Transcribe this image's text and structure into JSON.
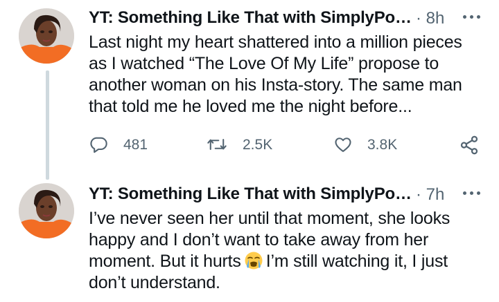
{
  "thread": {
    "tweets": [
      {
        "author": "YT: Something Like That with SimplyPo…",
        "separator": "·",
        "time": "8h",
        "lines": [
          "Last night my heart shattered into a million pieces",
          "as I watched “The Love Of My Life” propose to",
          "another woman on his Insta-story. The same man",
          "that told me he loved me the night before..."
        ],
        "actions": {
          "replies": "481",
          "retweets": "2.5K",
          "likes": "3.8K"
        }
      },
      {
        "author": "YT: Something Like That with SimplyPo…",
        "separator": "·",
        "time": "7h",
        "lines": [
          "I’ve never seen her until that moment, she looks",
          "happy and I don’t want to take away from her",
          "don’t understand."
        ],
        "line3_before_emoji": "moment. But it hurts",
        "line3_after_emoji": "I’m still watching it, I just",
        "emoji": "loudly-crying-face"
      }
    ]
  },
  "icons": {
    "more": "more-horizontal-icon",
    "reply": "reply-icon",
    "retweet": "retweet-icon",
    "like": "heart-icon",
    "share": "share-icon"
  },
  "colors": {
    "text": "#0f1419",
    "secondary": "#536471",
    "thread_line": "#cfd9de"
  }
}
